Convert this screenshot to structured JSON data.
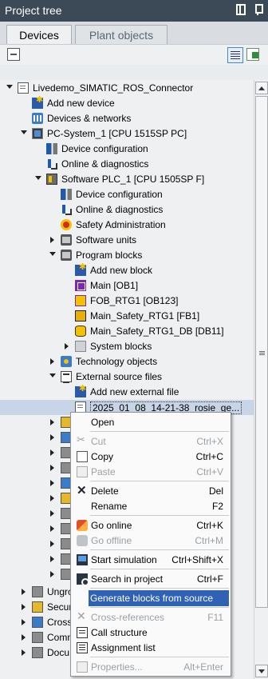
{
  "panel": {
    "title": "Project tree"
  },
  "tabs": [
    {
      "label": "Devices",
      "active": true
    },
    {
      "label": "Plant objects",
      "active": false
    }
  ],
  "tree": {
    "rows": [
      {
        "label": "Livedemo_SIMATIC_ROS_Connector",
        "icon": "project-icon",
        "expanded": true
      },
      {
        "label": "Add new device",
        "icon": "add-new-icon"
      },
      {
        "label": "Devices & networks",
        "icon": "network-icon"
      },
      {
        "label": "PC-System_1 [CPU 1515SP PC]",
        "icon": "pc-system-icon",
        "expanded": true
      },
      {
        "label": "Device configuration",
        "icon": "device-config-icon"
      },
      {
        "label": "Online & diagnostics",
        "icon": "diagnostics-icon"
      },
      {
        "label": "Software PLC_1 [CPU 1505SP F]",
        "icon": "plc-icon",
        "expanded": true
      },
      {
        "label": "Device configuration",
        "icon": "device-config-icon"
      },
      {
        "label": "Online & diagnostics",
        "icon": "diagnostics-icon"
      },
      {
        "label": "Safety Administration",
        "icon": "safety-icon"
      },
      {
        "label": "Software units",
        "icon": "folder-icon",
        "expanded": false
      },
      {
        "label": "Program blocks",
        "icon": "folder-icon",
        "expanded": true
      },
      {
        "label": "Add new block",
        "icon": "add-new-icon"
      },
      {
        "label": "Main [OB1]",
        "icon": "ob-icon"
      },
      {
        "label": "FOB_RTG1 [OB123]",
        "icon": "fob-icon"
      },
      {
        "label": "Main_Safety_RTG1 [FB1]",
        "icon": "fb-icon"
      },
      {
        "label": "Main_Safety_RTG1_DB [DB11]",
        "icon": "db-icon"
      },
      {
        "label": "System blocks",
        "icon": "system-blocks-icon",
        "expanded": false
      },
      {
        "label": "Technology objects",
        "icon": "technology-icon",
        "expanded": false
      },
      {
        "label": "External source files",
        "icon": "external-source-icon",
        "expanded": true
      },
      {
        "label": "Add new external file",
        "icon": "add-new-icon"
      },
      {
        "label": "2025_01_08_14-21-38_rosie_ge...",
        "icon": "source-file-icon",
        "selected": true
      }
    ],
    "partial_rows": [
      {
        "label": "Ungro",
        "icon": "ungrouped-icon"
      },
      {
        "label": "Secur",
        "icon": "security-icon"
      },
      {
        "label": "Cross",
        "icon": "cross-device-icon"
      },
      {
        "label": "Comm",
        "icon": "common-data-icon"
      },
      {
        "label": "Docu",
        "icon": "documentation-icon"
      }
    ]
  },
  "context_menu": {
    "items": [
      {
        "label": "Open",
        "shortcut": "",
        "icon": "",
        "disabled": false
      },
      {
        "sep": true
      },
      {
        "label": "Cut",
        "shortcut": "Ctrl+X",
        "icon": "cut",
        "disabled": true
      },
      {
        "label": "Copy",
        "shortcut": "Ctrl+C",
        "icon": "copy",
        "disabled": false
      },
      {
        "label": "Paste",
        "shortcut": "Ctrl+V",
        "icon": "paste",
        "disabled": true
      },
      {
        "sep": true
      },
      {
        "label": "Delete",
        "shortcut": "Del",
        "icon": "del",
        "disabled": false
      },
      {
        "label": "Rename",
        "shortcut": "F2",
        "icon": "",
        "disabled": false
      },
      {
        "sep": true
      },
      {
        "label": "Go online",
        "shortcut": "Ctrl+K",
        "icon": "golive",
        "disabled": false
      },
      {
        "label": "Go offline",
        "shortcut": "Ctrl+M",
        "icon": "gooff",
        "disabled": true
      },
      {
        "sep": true
      },
      {
        "label": "Start simulation",
        "shortcut": "Ctrl+Shift+X",
        "icon": "sim",
        "disabled": false
      },
      {
        "sep": true
      },
      {
        "label": "Search in project",
        "shortcut": "Ctrl+F",
        "icon": "search",
        "disabled": false
      },
      {
        "sep": true
      },
      {
        "label": "Generate blocks from source",
        "shortcut": "",
        "icon": "",
        "disabled": false,
        "highlighted": true
      },
      {
        "sep": true
      },
      {
        "label": "Cross-references",
        "shortcut": "F11",
        "icon": "xref",
        "disabled": true
      },
      {
        "label": "Call structure",
        "shortcut": "",
        "icon": "call",
        "disabled": false
      },
      {
        "label": "Assignment list",
        "shortcut": "",
        "icon": "assign",
        "disabled": false
      },
      {
        "sep": true
      },
      {
        "label": "Properties...",
        "shortcut": "Alt+Enter",
        "icon": "props",
        "disabled": true
      }
    ]
  },
  "colors": {
    "titlebar": "#3c4a57",
    "highlight": "#2f62b5",
    "selected_row": "#c7d5e6"
  }
}
